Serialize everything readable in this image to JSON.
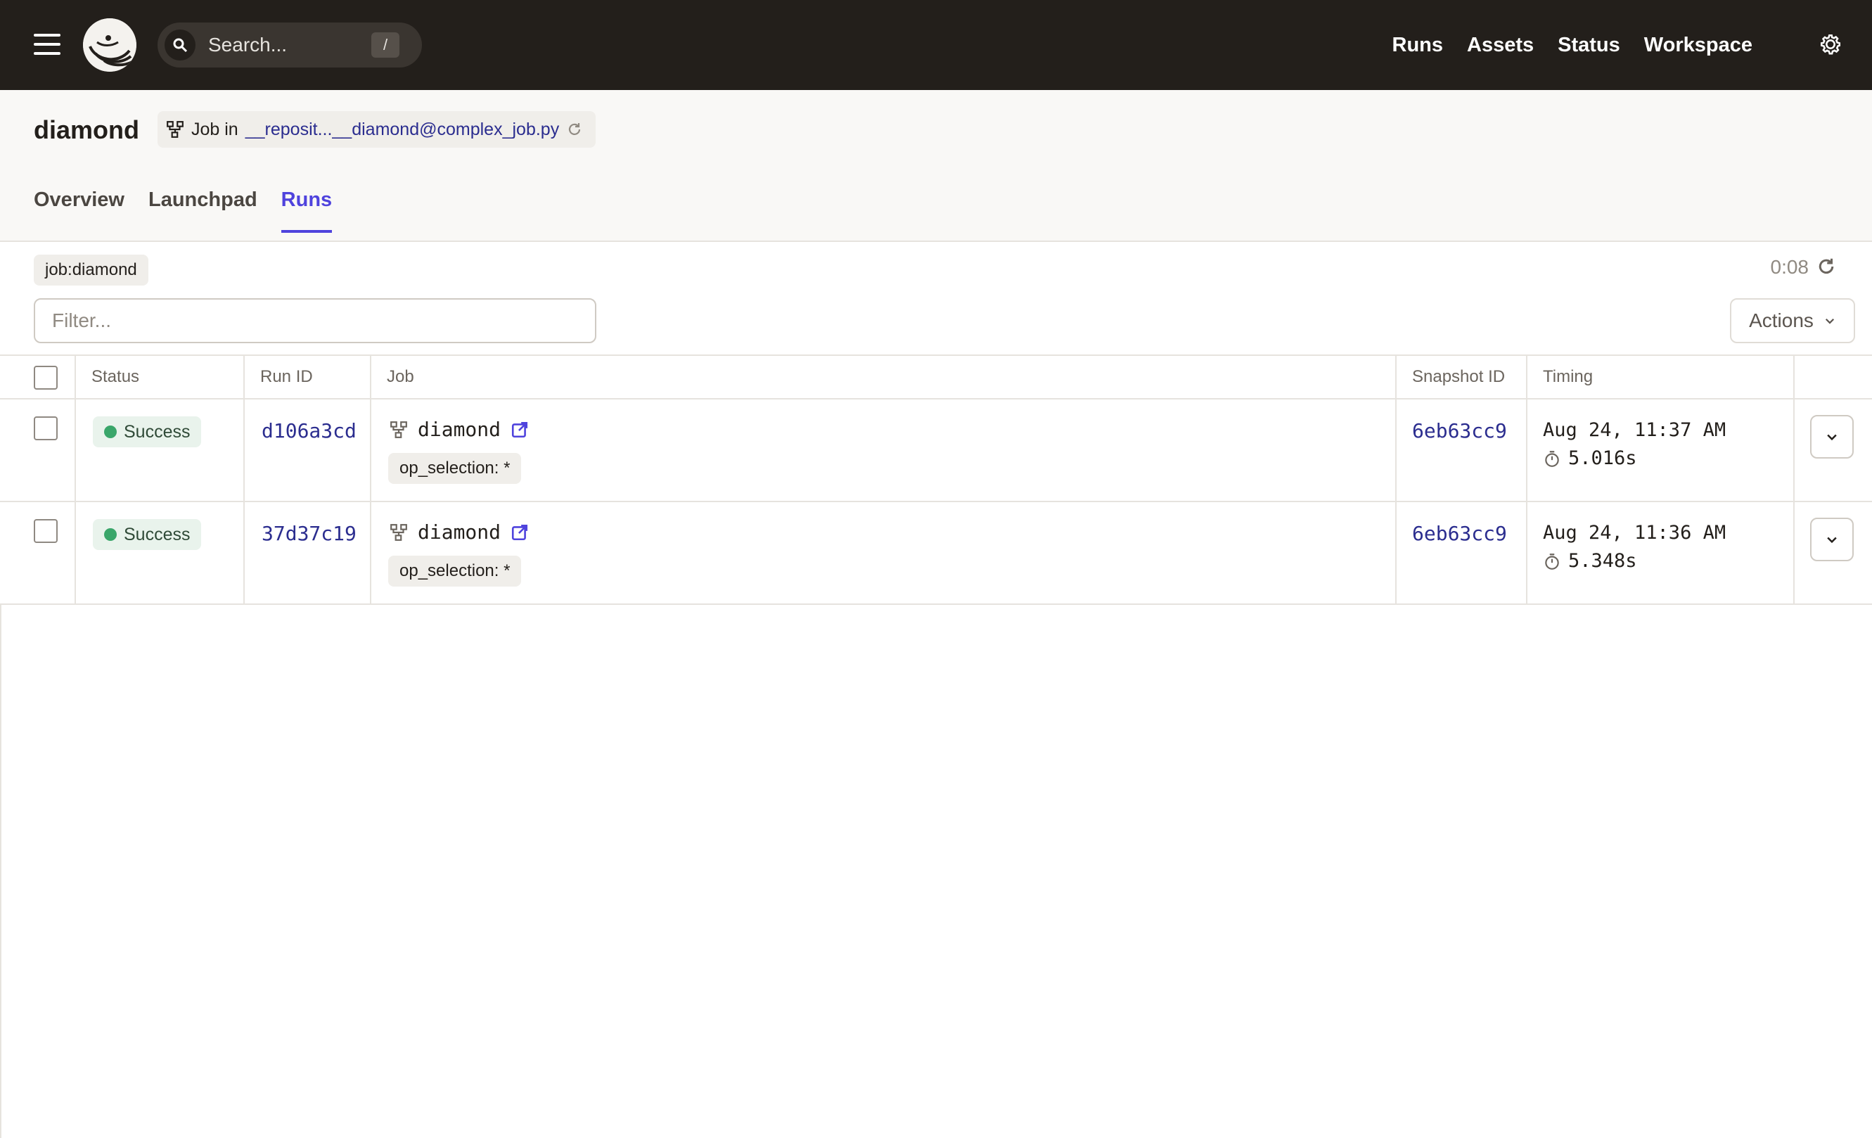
{
  "nav": {
    "search_placeholder": "Search...",
    "search_shortcut": "/",
    "links": [
      "Runs",
      "Assets",
      "Status",
      "Workspace"
    ]
  },
  "header": {
    "title": "diamond",
    "job_prefix": "Job in",
    "job_location": "__reposit...__diamond@complex_job.py",
    "tabs": [
      "Overview",
      "Launchpad",
      "Runs"
    ],
    "active_tab": "Runs"
  },
  "filters": {
    "chip": "job:diamond",
    "timer": "0:08",
    "filter_placeholder": "Filter...",
    "actions_label": "Actions"
  },
  "table": {
    "columns": [
      "Status",
      "Run ID",
      "Job",
      "Snapshot ID",
      "Timing"
    ],
    "rows": [
      {
        "status": "Success",
        "run_id": "d106a3cd",
        "job": "diamond",
        "op_selection": "op_selection: *",
        "snapshot_id": "6eb63cc9",
        "date": "Aug 24, 11:37 AM",
        "duration": "5.016s"
      },
      {
        "status": "Success",
        "run_id": "37d37c19",
        "job": "diamond",
        "op_selection": "op_selection: *",
        "snapshot_id": "6eb63cc9",
        "date": "Aug 24, 11:36 AM",
        "duration": "5.348s"
      }
    ]
  },
  "colors": {
    "topbar": "#231f1b",
    "accent": "#4f43dd",
    "link": "#2b2d8f",
    "success": "#3aa66a"
  }
}
